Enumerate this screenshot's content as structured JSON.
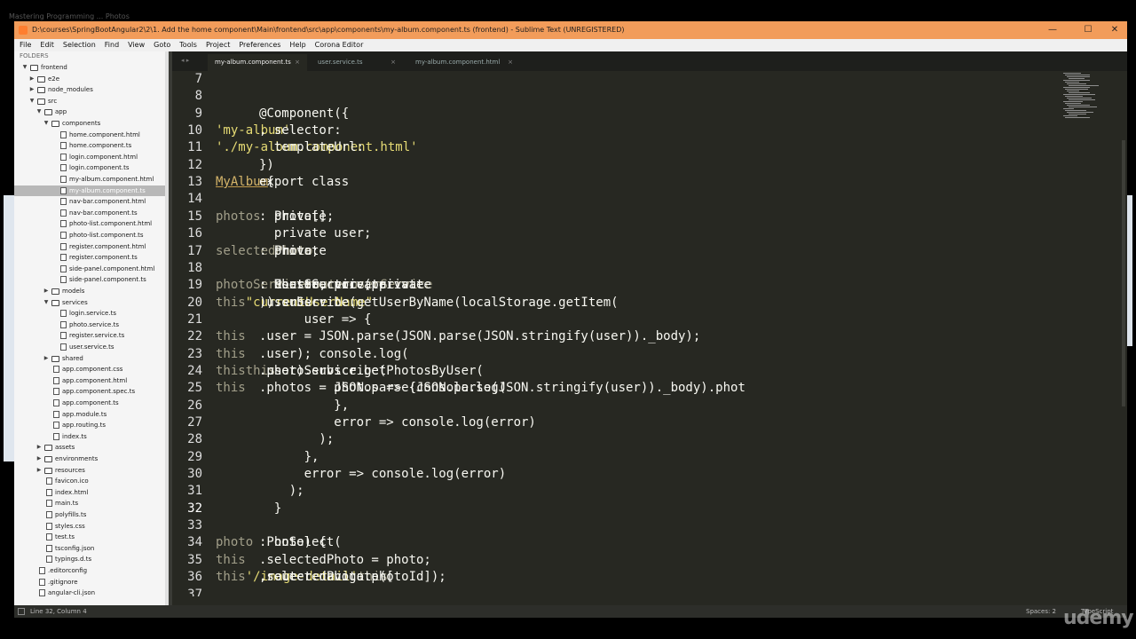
{
  "background_title": "Mastering Programming ... Photos",
  "window": {
    "title": "D:\\courses\\SpringBootAngular2\\2\\1. Add the home component\\Main\\frontend\\src\\app\\components\\my-album.component.ts (frontend) - Sublime Text (UNREGISTERED)",
    "controls": {
      "minimize": "—",
      "maximize": "☐",
      "close": "✕"
    },
    "accent": "#f29c5a"
  },
  "menu": [
    "File",
    "Edit",
    "Selection",
    "Find",
    "View",
    "Goto",
    "Tools",
    "Project",
    "Preferences",
    "Help",
    "Corona Editor"
  ],
  "sidebar": {
    "header": "FOLDERS",
    "items": [
      {
        "label": "frontend",
        "type": "folder",
        "depth": 0,
        "open": true
      },
      {
        "label": "e2e",
        "type": "folder",
        "depth": 1,
        "open": false
      },
      {
        "label": "node_modules",
        "type": "folder",
        "depth": 1,
        "open": false
      },
      {
        "label": "src",
        "type": "folder",
        "depth": 1,
        "open": true
      },
      {
        "label": "app",
        "type": "folder",
        "depth": 2,
        "open": true
      },
      {
        "label": "components",
        "type": "folder",
        "depth": 3,
        "open": true
      },
      {
        "label": "home.component.html",
        "type": "file",
        "depth": 4
      },
      {
        "label": "home.component.ts",
        "type": "file",
        "depth": 4
      },
      {
        "label": "login.component.html",
        "type": "file",
        "depth": 4
      },
      {
        "label": "login.component.ts",
        "type": "file",
        "depth": 4
      },
      {
        "label": "my-album.component.html",
        "type": "file",
        "depth": 4
      },
      {
        "label": "my-album.component.ts",
        "type": "file",
        "depth": 4,
        "selected": true
      },
      {
        "label": "nav-bar.component.html",
        "type": "file",
        "depth": 4
      },
      {
        "label": "nav-bar.component.ts",
        "type": "file",
        "depth": 4
      },
      {
        "label": "photo-list.component.html",
        "type": "file",
        "depth": 4
      },
      {
        "label": "photo-list.component.ts",
        "type": "file",
        "depth": 4
      },
      {
        "label": "register.component.html",
        "type": "file",
        "depth": 4
      },
      {
        "label": "register.component.ts",
        "type": "file",
        "depth": 4
      },
      {
        "label": "side-panel.component.html",
        "type": "file",
        "depth": 4
      },
      {
        "label": "side-panel.component.ts",
        "type": "file",
        "depth": 4
      },
      {
        "label": "models",
        "type": "folder",
        "depth": 3,
        "open": false
      },
      {
        "label": "services",
        "type": "folder",
        "depth": 3,
        "open": true
      },
      {
        "label": "login.service.ts",
        "type": "file",
        "depth": 4
      },
      {
        "label": "photo.service.ts",
        "type": "file",
        "depth": 4
      },
      {
        "label": "register.service.ts",
        "type": "file",
        "depth": 4
      },
      {
        "label": "user.service.ts",
        "type": "file",
        "depth": 4
      },
      {
        "label": "shared",
        "type": "folder",
        "depth": 3,
        "open": false
      },
      {
        "label": "app.component.css",
        "type": "file",
        "depth": 3
      },
      {
        "label": "app.component.html",
        "type": "file",
        "depth": 3
      },
      {
        "label": "app.component.spec.ts",
        "type": "file",
        "depth": 3
      },
      {
        "label": "app.component.ts",
        "type": "file",
        "depth": 3
      },
      {
        "label": "app.module.ts",
        "type": "file",
        "depth": 3
      },
      {
        "label": "app.routing.ts",
        "type": "file",
        "depth": 3
      },
      {
        "label": "index.ts",
        "type": "file",
        "depth": 3
      },
      {
        "label": "assets",
        "type": "folder",
        "depth": 2,
        "open": false
      },
      {
        "label": "environments",
        "type": "folder",
        "depth": 2,
        "open": false
      },
      {
        "label": "resources",
        "type": "folder",
        "depth": 2,
        "open": false
      },
      {
        "label": "favicon.ico",
        "type": "image",
        "depth": 2
      },
      {
        "label": "index.html",
        "type": "file",
        "depth": 2
      },
      {
        "label": "main.ts",
        "type": "file",
        "depth": 2
      },
      {
        "label": "polyfills.ts",
        "type": "file",
        "depth": 2
      },
      {
        "label": "styles.css",
        "type": "file",
        "depth": 2
      },
      {
        "label": "test.ts",
        "type": "file",
        "depth": 2
      },
      {
        "label": "tsconfig.json",
        "type": "file",
        "depth": 2
      },
      {
        "label": "typings.d.ts",
        "type": "file",
        "depth": 2
      },
      {
        "label": ".editorconfig",
        "type": "file",
        "depth": 1
      },
      {
        "label": ".gitignore",
        "type": "file",
        "depth": 1
      },
      {
        "label": "angular-cli.json",
        "type": "file",
        "depth": 1
      }
    ]
  },
  "tabs": [
    {
      "label": "my-album.component.ts",
      "active": true,
      "close": "×"
    },
    {
      "label": "user.service.ts",
      "active": false,
      "close": "×"
    },
    {
      "label": "my-album.component.html",
      "active": false,
      "close": "×"
    }
  ],
  "nav_arrows": "◂ ▸",
  "current_line": 32,
  "code": [
    {
      "n": "7",
      "segs": []
    },
    {
      "n": "8",
      "segs": []
    },
    {
      "n": "9",
      "segs": [
        [
          "@Component({",
          "txt"
        ]
      ]
    },
    {
      "n": "10",
      "segs": [
        [
          "  selector: ",
          "txt"
        ],
        [
          "'my-album'",
          "str"
        ],
        [
          ",",
          "txt"
        ]
      ]
    },
    {
      "n": "11",
      "segs": [
        [
          "  templateUrl: ",
          "txt"
        ],
        [
          "'./my-album.component.html'",
          "str"
        ]
      ]
    },
    {
      "n": "12",
      "segs": [
        [
          "})",
          "txt"
        ]
      ]
    },
    {
      "n": "13",
      "segs": [
        [
          "export class ",
          "txt"
        ],
        [
          "MyAlbum",
          "cls"
        ],
        [
          " {",
          "txt"
        ]
      ]
    },
    {
      "n": "14",
      "segs": []
    },
    {
      "n": "15",
      "segs": [
        [
          "  private ",
          "txt"
        ],
        [
          "photos",
          "pl"
        ],
        [
          ": Photo[];",
          "txt"
        ]
      ]
    },
    {
      "n": "16",
      "segs": [
        [
          "  private user;",
          "txt"
        ]
      ]
    },
    {
      "n": "17",
      "segs": [
        [
          "  private ",
          "txt"
        ],
        [
          "selectedPhoto",
          "pl"
        ],
        [
          ": Photo;",
          "txt"
        ]
      ]
    },
    {
      "n": "18",
      "segs": []
    },
    {
      "n": "19",
      "segs": [
        [
          "  constructor (private ",
          "txt"
        ],
        [
          "photoService",
          "pl"
        ],
        [
          ": PhotoService, private ",
          "txt"
        ],
        [
          "router",
          "pl"
        ],
        [
          ": Router, private ",
          "txt"
        ],
        [
          "userService",
          "pl"
        ],
        [
          ": UserSe",
          "txt"
        ]
      ]
    },
    {
      "n": "20",
      "segs": [
        [
          "    ",
          "txt"
        ],
        [
          "this",
          "pl"
        ],
        [
          ".userService.getUserByName(localStorage.getItem(",
          "txt"
        ],
        [
          "\"currentUserName\"",
          "str"
        ],
        [
          ")).subscribe(",
          "txt"
        ]
      ]
    },
    {
      "n": "21",
      "segs": [
        [
          "      user => {",
          "txt"
        ]
      ]
    },
    {
      "n": "22",
      "segs": [
        [
          "        ",
          "txt"
        ],
        [
          "this",
          "pl"
        ],
        [
          ".user = JSON.parse(JSON.parse(JSON.stringify(user))._body);",
          "txt"
        ]
      ]
    },
    {
      "n": "23",
      "segs": [
        [
          "        console.log(",
          "txt"
        ],
        [
          "this",
          "pl"
        ],
        [
          ".user);",
          "txt"
        ]
      ]
    },
    {
      "n": "24",
      "segs": [
        [
          "        ",
          "txt"
        ],
        [
          "this",
          "pl"
        ],
        [
          ".photoService.getPhotosByUser(",
          "txt"
        ],
        [
          "this",
          "pl"
        ],
        [
          ".user).subscribe(",
          "txt"
        ]
      ]
    },
    {
      "n": "25",
      "segs": [
        [
          "          photos => {console.log(",
          "txt"
        ],
        [
          "this",
          "pl"
        ],
        [
          ".photos = JSON.parse(JSON.parse(JSON.stringify(user))._body).phot",
          "txt"
        ]
      ]
    },
    {
      "n": "26",
      "segs": [
        [
          "          },",
          "txt"
        ]
      ]
    },
    {
      "n": "27",
      "segs": [
        [
          "          error => console.log(error)",
          "txt"
        ]
      ]
    },
    {
      "n": "28",
      "segs": [
        [
          "        );",
          "txt"
        ]
      ]
    },
    {
      "n": "29",
      "segs": [
        [
          "      },",
          "txt"
        ]
      ]
    },
    {
      "n": "30",
      "segs": [
        [
          "      error => console.log(error)",
          "txt"
        ]
      ]
    },
    {
      "n": "31",
      "segs": [
        [
          "    );",
          "txt"
        ]
      ]
    },
    {
      "n": "32",
      "segs": [
        [
          "  }",
          "txt"
        ]
      ]
    },
    {
      "n": "33",
      "segs": []
    },
    {
      "n": "34",
      "segs": [
        [
          "  onSelect(",
          "txt"
        ],
        [
          "photo",
          "pl"
        ],
        [
          ":Photo) {",
          "txt"
        ]
      ]
    },
    {
      "n": "35",
      "segs": [
        [
          "    ",
          "txt"
        ],
        [
          "this",
          "pl"
        ],
        [
          ".selectedPhoto = photo;",
          "txt"
        ]
      ]
    },
    {
      "n": "36",
      "segs": [
        [
          "    ",
          "txt"
        ],
        [
          "this",
          "pl"
        ],
        [
          ".router.navigate([",
          "txt"
        ],
        [
          "'/image-detail'",
          "str"
        ],
        [
          ", ",
          "txt"
        ],
        [
          "this",
          "pl"
        ],
        [
          ".selectedPhoto.photoId]);",
          "txt"
        ]
      ]
    },
    {
      "n": "37",
      "segs": []
    }
  ],
  "status": {
    "position": "Line 32, Column 4",
    "spaces": "Spaces: 2",
    "syntax": "TypeScript"
  },
  "watermark": "udemy",
  "colors": {
    "editor_bg": "#272822",
    "string": "#e6db74",
    "placeholder_text": "#a29f8a",
    "sidebar_bg": "#f5f5f5",
    "selection": "#b8b8b8"
  }
}
